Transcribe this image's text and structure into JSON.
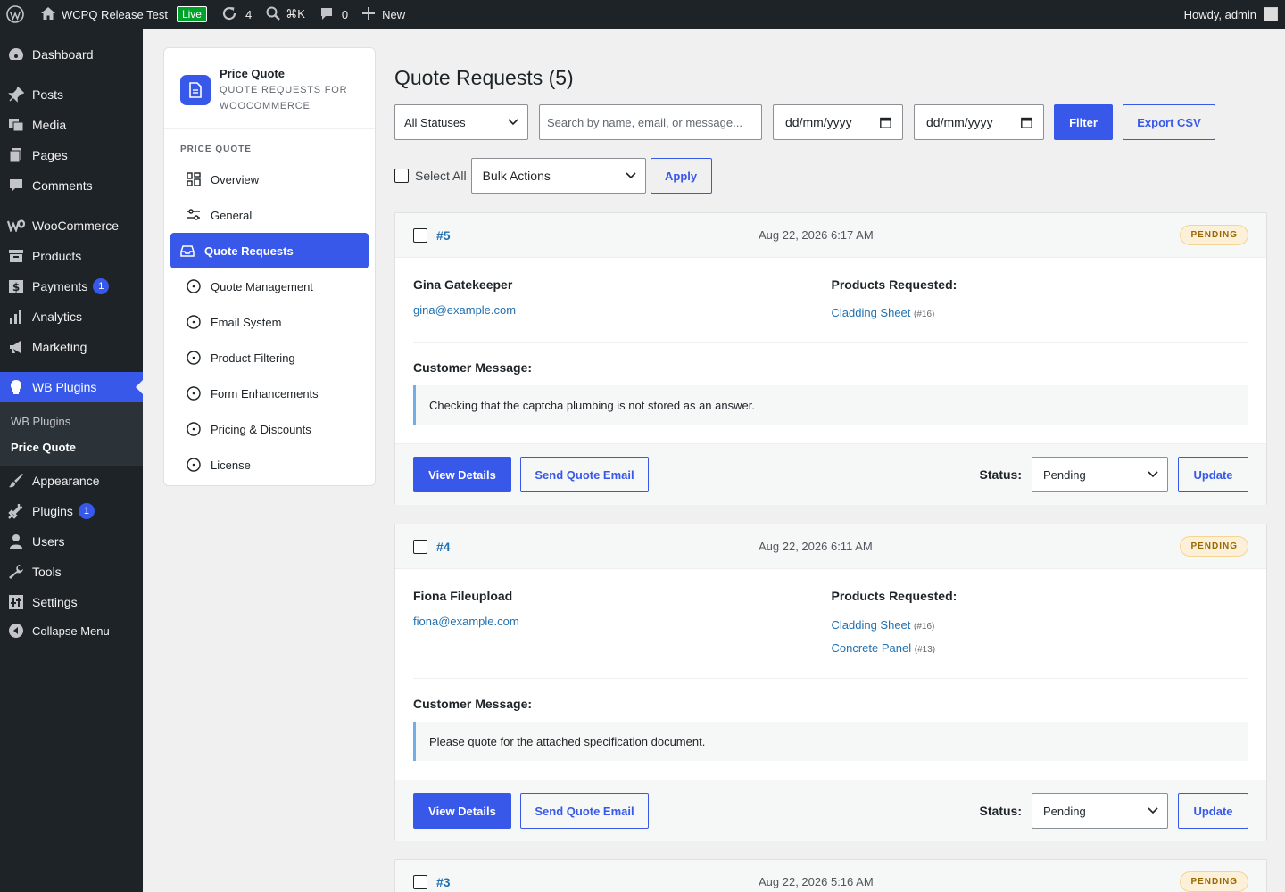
{
  "adminbar": {
    "site_name": "WCPQ Release Test",
    "live_label": "Live",
    "updates_count": "4",
    "shortcut": "⌘K",
    "comments_count": "0",
    "new_label": "New",
    "howdy": "Howdy, admin"
  },
  "sidebar": {
    "items": [
      {
        "label": "Dashboard",
        "icon": "dashboard-icon"
      },
      {
        "label": "Posts",
        "icon": "pin-icon"
      },
      {
        "label": "Media",
        "icon": "media-icon"
      },
      {
        "label": "Pages",
        "icon": "pages-icon"
      },
      {
        "label": "Comments",
        "icon": "comment-icon"
      },
      {
        "label": "WooCommerce",
        "icon": "woo-icon"
      },
      {
        "label": "Products",
        "icon": "archive-icon"
      },
      {
        "label": "Payments",
        "icon": "dollar-icon",
        "badge": "1"
      },
      {
        "label": "Analytics",
        "icon": "chart-icon"
      },
      {
        "label": "Marketing",
        "icon": "megaphone-icon"
      },
      {
        "label": "WB Plugins",
        "icon": "bulb-icon"
      },
      {
        "label": "Appearance",
        "icon": "brush-icon"
      },
      {
        "label": "Plugins",
        "icon": "plug-icon",
        "badge": "1"
      },
      {
        "label": "Users",
        "icon": "user-icon"
      },
      {
        "label": "Tools",
        "icon": "wrench-icon"
      },
      {
        "label": "Settings",
        "icon": "settings-icon"
      },
      {
        "label": "Collapse Menu",
        "icon": "collapse-icon"
      }
    ],
    "submenu": [
      "WB Plugins",
      "Price Quote"
    ]
  },
  "plugin_nav": {
    "title": "Price Quote",
    "subtitle_line1": "QUOTE REQUESTS FOR",
    "subtitle_line2": "WOOCOMMERCE",
    "section": "PRICE QUOTE",
    "items": [
      {
        "label": "Overview",
        "icon": "grid-icon"
      },
      {
        "label": "General",
        "icon": "sliders-icon"
      },
      {
        "label": "Quote Requests",
        "icon": "inbox-icon"
      },
      {
        "label": "Quote Management",
        "icon": "circle-dot-icon"
      },
      {
        "label": "Email System",
        "icon": "circle-dot-icon"
      },
      {
        "label": "Product Filtering",
        "icon": "circle-dot-icon"
      },
      {
        "label": "Form Enhancements",
        "icon": "circle-dot-icon"
      },
      {
        "label": "Pricing & Discounts",
        "icon": "circle-dot-icon"
      },
      {
        "label": "License",
        "icon": "circle-dot-icon"
      }
    ]
  },
  "main": {
    "title": "Quote Requests (5)",
    "filters": {
      "status_select": "All Statuses",
      "search_placeholder": "Search by name, email, or message...",
      "date_from": "dd/mm/yyyy",
      "date_to": "dd/mm/yyyy",
      "filter_label": "Filter",
      "export_label": "Export CSV"
    },
    "bulk": {
      "select_all": "Select All",
      "bulk_actions": "Bulk Actions",
      "apply": "Apply"
    },
    "quotes": [
      {
        "id": "#5",
        "date": "Aug 22, 2026 6:17 AM",
        "status_pill": "PENDING",
        "name": "Gina Gatekeeper",
        "email": "gina@example.com",
        "products_heading": "Products Requested:",
        "products": [
          {
            "name": "Cladding Sheet",
            "pid": "(#16)"
          }
        ],
        "message_heading": "Customer Message:",
        "message": "Checking that the captcha plumbing is not stored as an answer.",
        "view_label": "View Details",
        "send_label": "Send Quote Email",
        "status_label": "Status:",
        "status_value": "Pending",
        "update_label": "Update"
      },
      {
        "id": "#4",
        "date": "Aug 22, 2026 6:11 AM",
        "status_pill": "PENDING",
        "name": "Fiona Fileupload",
        "email": "fiona@example.com",
        "products_heading": "Products Requested:",
        "products": [
          {
            "name": "Cladding Sheet",
            "pid": "(#16)"
          },
          {
            "name": "Concrete Panel",
            "pid": "(#13)"
          }
        ],
        "message_heading": "Customer Message:",
        "message": "Please quote for the attached specification document.",
        "view_label": "View Details",
        "send_label": "Send Quote Email",
        "status_label": "Status:",
        "status_value": "Pending",
        "update_label": "Update"
      },
      {
        "id": "#3",
        "date": "Aug 22, 2026 5:16 AM",
        "status_pill": "PENDING"
      }
    ]
  },
  "colors": {
    "accent": "#3858e9",
    "link": "#2271b1",
    "adminbar_bg": "#1d2327",
    "pill_bg": "#fcf0d9",
    "pill_text": "#996800"
  }
}
